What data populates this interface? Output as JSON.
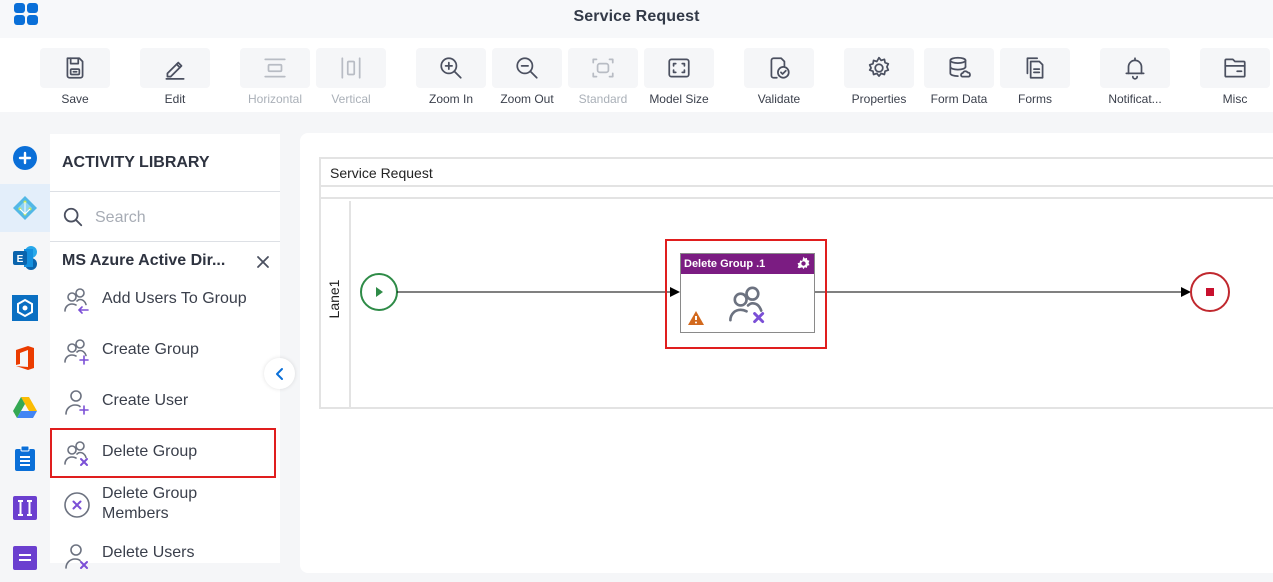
{
  "header": {
    "title": "Service Request",
    "app_menu_icon": "app-grid-icon"
  },
  "toolbar": {
    "buttons": [
      {
        "label": "Save",
        "icon": "save-icon",
        "enabled": true
      },
      {
        "label": "Edit",
        "icon": "edit-icon",
        "enabled": true
      },
      {
        "label": "Horizontal",
        "icon": "horizontal-layout-icon",
        "enabled": false
      },
      {
        "label": "Vertical",
        "icon": "vertical-layout-icon",
        "enabled": false
      },
      {
        "label": "Zoom In",
        "icon": "zoom-in-icon",
        "enabled": true
      },
      {
        "label": "Zoom Out",
        "icon": "zoom-out-icon",
        "enabled": true
      },
      {
        "label": "Standard",
        "icon": "standard-size-icon",
        "enabled": false
      },
      {
        "label": "Model Size",
        "icon": "model-size-icon",
        "enabled": true
      },
      {
        "label": "Validate",
        "icon": "validate-icon",
        "enabled": true
      },
      {
        "label": "Properties",
        "icon": "gear-icon",
        "enabled": true
      },
      {
        "label": "Form Data",
        "icon": "database-icon",
        "enabled": true
      },
      {
        "label": "Forms",
        "icon": "forms-icon",
        "enabled": true
      },
      {
        "label": "Notificat...",
        "icon": "bell-icon",
        "enabled": true
      },
      {
        "label": "Misc",
        "icon": "folder-icon",
        "enabled": true
      }
    ]
  },
  "left_rail": {
    "items": [
      {
        "name": "add",
        "icon": "plus-circle-icon",
        "active": false
      },
      {
        "name": "azure-active-directory",
        "icon": "azure-ad-icon",
        "active": true
      },
      {
        "name": "exchange",
        "icon": "exchange-icon",
        "active": false
      },
      {
        "name": "azure-service",
        "icon": "hexagon-service-icon",
        "active": false
      },
      {
        "name": "office-365",
        "icon": "office-icon",
        "active": false
      },
      {
        "name": "google-drive",
        "icon": "google-drive-icon",
        "active": false
      },
      {
        "name": "tasks",
        "icon": "clipboard-icon",
        "active": false
      },
      {
        "name": "text-tool",
        "icon": "text-cursor-icon",
        "active": false
      },
      {
        "name": "forms-tool",
        "icon": "list-icon",
        "active": false
      }
    ]
  },
  "library": {
    "title": "ACTIVITY LIBRARY",
    "search_placeholder": "Search",
    "search_value": "",
    "category": "MS Azure Active Dir...",
    "items": [
      {
        "label": "Add Users To Group",
        "icon": "add-users-to-group-icon",
        "selected": false
      },
      {
        "label": "Create Group",
        "icon": "create-group-icon",
        "selected": false
      },
      {
        "label": "Create User",
        "icon": "create-user-icon",
        "selected": false
      },
      {
        "label": "Delete Group",
        "icon": "delete-group-icon",
        "selected": true
      },
      {
        "label": "Delete Group Members",
        "icon": "delete-group-members-icon",
        "selected": false
      },
      {
        "label": "Delete Users",
        "icon": "delete-users-icon",
        "selected": false
      }
    ]
  },
  "diagram": {
    "pool_title": "Service Request",
    "lane_label": "Lane1",
    "start_event": "start",
    "task": {
      "name": "Delete Group .1",
      "icon": "delete-group-icon",
      "warning": true
    },
    "end_event": "end"
  },
  "colors": {
    "accent": "#0a6fd8",
    "task_header": "#7b1c82",
    "highlight": "#e01e1e",
    "start_event": "#2e8b47",
    "end_event": "#c0282e",
    "warning": "#d2691e",
    "activity_icon_accent": "#7b4fd6"
  }
}
